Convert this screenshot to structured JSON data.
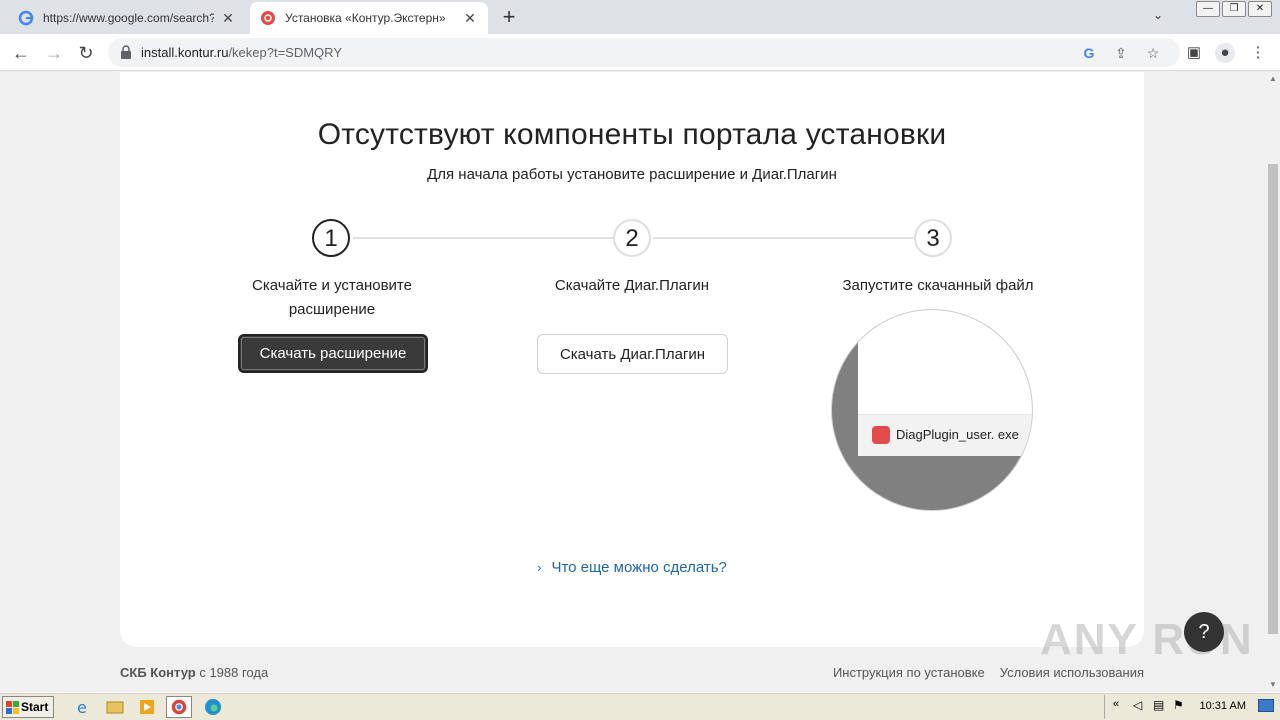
{
  "browser": {
    "tabs": [
      {
        "title": "https://www.google.com/search?q=",
        "active": false
      },
      {
        "title": "Установка «Контур.Экстерн»",
        "active": true
      }
    ],
    "url_host": "install.kontur.ru",
    "url_path": "/kekep?t=SDMQRY"
  },
  "page": {
    "heading": "Отсутствуют компоненты портала установки",
    "subheading": "Для начала работы установите расширение и Диаг.Плагин",
    "steps": [
      {
        "number": "1",
        "label_line1": "Скачайте и установите",
        "label_line2": "расширение",
        "button": "Скачать расширение"
      },
      {
        "number": "2",
        "label_line1": "Скачайте Диаг.Плагин",
        "label_line2": "",
        "button": "Скачать Диаг.Плагин"
      },
      {
        "number": "3",
        "label_line1": "Запустите скачанный файл",
        "label_line2": "",
        "file_name": "DiagPlugin_user. exe"
      }
    ],
    "more_link": "Что еще можно сделать?",
    "help_label": "?"
  },
  "footer": {
    "brand": "СКБ Контур",
    "since": "с 1988 года",
    "links": [
      "Инструкция по установке",
      "Условия использования"
    ]
  },
  "taskbar": {
    "start_label": "Start",
    "clock": "10:31 AM"
  },
  "watermark": "ANY RUN",
  "colors": {
    "accent_link": "#1f67a9",
    "dark_button": "#3a3a3a",
    "brand_red": "#e24b47"
  }
}
